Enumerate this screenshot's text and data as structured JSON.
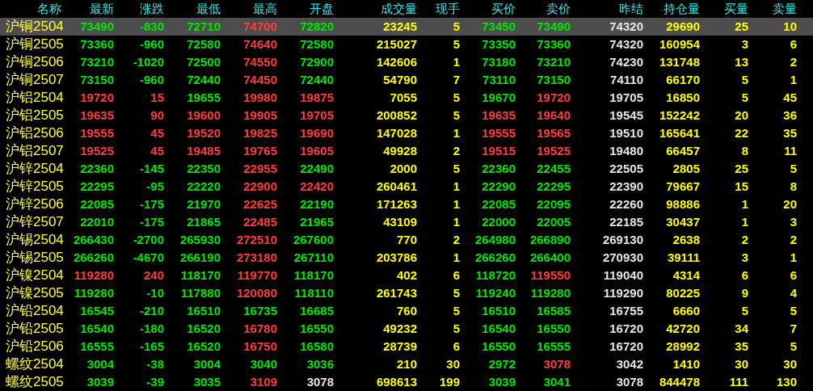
{
  "columns": [
    "名称",
    "最新",
    "涨跌",
    "最低",
    "最高",
    "开盘",
    "成交量",
    "现手",
    "买价",
    "卖价",
    "昨结",
    "持仓量",
    "买量",
    "卖量"
  ],
  "rows": [
    {
      "name": "沪铜2504",
      "selected": true,
      "cells": [
        {
          "text": "73490",
          "color": "#00e600"
        },
        {
          "text": "-830",
          "color": "#00e600"
        },
        {
          "text": "72710",
          "color": "#00e600"
        },
        {
          "text": "74700",
          "color": "#ff3c3c"
        },
        {
          "text": "72820",
          "color": "#00e600"
        },
        {
          "text": "23245",
          "color": "#ffff00"
        },
        {
          "text": "5",
          "color": "#ffff00"
        },
        {
          "text": "73450",
          "color": "#00e600"
        },
        {
          "text": "73490",
          "color": "#00e600"
        },
        {
          "text": "74320",
          "color": "#e6e6e6"
        },
        {
          "text": "29690",
          "color": "#ffff00"
        },
        {
          "text": "25",
          "color": "#ffff00"
        },
        {
          "text": "10",
          "color": "#ffff00"
        }
      ]
    },
    {
      "name": "沪铜2505",
      "selected": false,
      "cells": [
        {
          "text": "73360",
          "color": "#00e600"
        },
        {
          "text": "-960",
          "color": "#00e600"
        },
        {
          "text": "72580",
          "color": "#00e600"
        },
        {
          "text": "74640",
          "color": "#ff3c3c"
        },
        {
          "text": "72580",
          "color": "#00e600"
        },
        {
          "text": "215027",
          "color": "#ffff00"
        },
        {
          "text": "5",
          "color": "#ffff00"
        },
        {
          "text": "73350",
          "color": "#00e600"
        },
        {
          "text": "73360",
          "color": "#00e600"
        },
        {
          "text": "74320",
          "color": "#e6e6e6"
        },
        {
          "text": "160954",
          "color": "#ffff00"
        },
        {
          "text": "3",
          "color": "#ffff00"
        },
        {
          "text": "6",
          "color": "#ffff00"
        }
      ]
    },
    {
      "name": "沪铜2506",
      "selected": false,
      "cells": [
        {
          "text": "73210",
          "color": "#00e600"
        },
        {
          "text": "-1020",
          "color": "#00e600"
        },
        {
          "text": "72500",
          "color": "#00e600"
        },
        {
          "text": "74550",
          "color": "#ff3c3c"
        },
        {
          "text": "72900",
          "color": "#00e600"
        },
        {
          "text": "142606",
          "color": "#ffff00"
        },
        {
          "text": "1",
          "color": "#ffff00"
        },
        {
          "text": "73180",
          "color": "#00e600"
        },
        {
          "text": "73210",
          "color": "#00e600"
        },
        {
          "text": "74230",
          "color": "#e6e6e6"
        },
        {
          "text": "131748",
          "color": "#ffff00"
        },
        {
          "text": "13",
          "color": "#ffff00"
        },
        {
          "text": "2",
          "color": "#ffff00"
        }
      ]
    },
    {
      "name": "沪铜2507",
      "selected": false,
      "cells": [
        {
          "text": "73150",
          "color": "#00e600"
        },
        {
          "text": "-960",
          "color": "#00e600"
        },
        {
          "text": "72440",
          "color": "#00e600"
        },
        {
          "text": "74450",
          "color": "#ff3c3c"
        },
        {
          "text": "72440",
          "color": "#00e600"
        },
        {
          "text": "54790",
          "color": "#ffff00"
        },
        {
          "text": "7",
          "color": "#ffff00"
        },
        {
          "text": "73110",
          "color": "#00e600"
        },
        {
          "text": "73150",
          "color": "#00e600"
        },
        {
          "text": "74110",
          "color": "#e6e6e6"
        },
        {
          "text": "66170",
          "color": "#ffff00"
        },
        {
          "text": "5",
          "color": "#ffff00"
        },
        {
          "text": "1",
          "color": "#ffff00"
        }
      ]
    },
    {
      "name": "沪铝2504",
      "selected": false,
      "cells": [
        {
          "text": "19720",
          "color": "#ff3c3c"
        },
        {
          "text": "15",
          "color": "#ff3c3c"
        },
        {
          "text": "19655",
          "color": "#00e600"
        },
        {
          "text": "19980",
          "color": "#ff3c3c"
        },
        {
          "text": "19875",
          "color": "#ff3c3c"
        },
        {
          "text": "7055",
          "color": "#ffff00"
        },
        {
          "text": "5",
          "color": "#ffff00"
        },
        {
          "text": "19670",
          "color": "#00e600"
        },
        {
          "text": "19720",
          "color": "#ff3c3c"
        },
        {
          "text": "19705",
          "color": "#e6e6e6"
        },
        {
          "text": "16850",
          "color": "#ffff00"
        },
        {
          "text": "5",
          "color": "#ffff00"
        },
        {
          "text": "45",
          "color": "#ffff00"
        }
      ]
    },
    {
      "name": "沪铝2505",
      "selected": false,
      "cells": [
        {
          "text": "19635",
          "color": "#ff3c3c"
        },
        {
          "text": "90",
          "color": "#ff3c3c"
        },
        {
          "text": "19600",
          "color": "#ff3c3c"
        },
        {
          "text": "19905",
          "color": "#ff3c3c"
        },
        {
          "text": "19705",
          "color": "#ff3c3c"
        },
        {
          "text": "200852",
          "color": "#ffff00"
        },
        {
          "text": "5",
          "color": "#ffff00"
        },
        {
          "text": "19635",
          "color": "#ff3c3c"
        },
        {
          "text": "19640",
          "color": "#ff3c3c"
        },
        {
          "text": "19545",
          "color": "#e6e6e6"
        },
        {
          "text": "152242",
          "color": "#ffff00"
        },
        {
          "text": "20",
          "color": "#ffff00"
        },
        {
          "text": "36",
          "color": "#ffff00"
        }
      ]
    },
    {
      "name": "沪铝2506",
      "selected": false,
      "cells": [
        {
          "text": "19555",
          "color": "#ff3c3c"
        },
        {
          "text": "45",
          "color": "#ff3c3c"
        },
        {
          "text": "19520",
          "color": "#ff3c3c"
        },
        {
          "text": "19825",
          "color": "#ff3c3c"
        },
        {
          "text": "19690",
          "color": "#ff3c3c"
        },
        {
          "text": "147028",
          "color": "#ffff00"
        },
        {
          "text": "1",
          "color": "#ffff00"
        },
        {
          "text": "19555",
          "color": "#ff3c3c"
        },
        {
          "text": "19565",
          "color": "#ff3c3c"
        },
        {
          "text": "19510",
          "color": "#e6e6e6"
        },
        {
          "text": "165641",
          "color": "#ffff00"
        },
        {
          "text": "22",
          "color": "#ffff00"
        },
        {
          "text": "35",
          "color": "#ffff00"
        }
      ]
    },
    {
      "name": "沪铝2507",
      "selected": false,
      "cells": [
        {
          "text": "19525",
          "color": "#ff3c3c"
        },
        {
          "text": "45",
          "color": "#ff3c3c"
        },
        {
          "text": "19485",
          "color": "#ff3c3c"
        },
        {
          "text": "19765",
          "color": "#ff3c3c"
        },
        {
          "text": "19605",
          "color": "#ff3c3c"
        },
        {
          "text": "49928",
          "color": "#ffff00"
        },
        {
          "text": "2",
          "color": "#ffff00"
        },
        {
          "text": "19515",
          "color": "#ff3c3c"
        },
        {
          "text": "19525",
          "color": "#ff3c3c"
        },
        {
          "text": "19480",
          "color": "#e6e6e6"
        },
        {
          "text": "66457",
          "color": "#ffff00"
        },
        {
          "text": "8",
          "color": "#ffff00"
        },
        {
          "text": "11",
          "color": "#ffff00"
        }
      ]
    },
    {
      "name": "沪锌2504",
      "selected": false,
      "cells": [
        {
          "text": "22360",
          "color": "#00e600"
        },
        {
          "text": "-145",
          "color": "#00e600"
        },
        {
          "text": "22350",
          "color": "#00e600"
        },
        {
          "text": "22955",
          "color": "#ff3c3c"
        },
        {
          "text": "22490",
          "color": "#00e600"
        },
        {
          "text": "2000",
          "color": "#ffff00"
        },
        {
          "text": "5",
          "color": "#ffff00"
        },
        {
          "text": "22360",
          "color": "#00e600"
        },
        {
          "text": "22455",
          "color": "#00e600"
        },
        {
          "text": "22505",
          "color": "#e6e6e6"
        },
        {
          "text": "2805",
          "color": "#ffff00"
        },
        {
          "text": "25",
          "color": "#ffff00"
        },
        {
          "text": "5",
          "color": "#ffff00"
        }
      ]
    },
    {
      "name": "沪锌2505",
      "selected": false,
      "cells": [
        {
          "text": "22295",
          "color": "#00e600"
        },
        {
          "text": "-95",
          "color": "#00e600"
        },
        {
          "text": "22220",
          "color": "#00e600"
        },
        {
          "text": "22900",
          "color": "#ff3c3c"
        },
        {
          "text": "22420",
          "color": "#ff3c3c"
        },
        {
          "text": "260461",
          "color": "#ffff00"
        },
        {
          "text": "1",
          "color": "#ffff00"
        },
        {
          "text": "22290",
          "color": "#00e600"
        },
        {
          "text": "22295",
          "color": "#00e600"
        },
        {
          "text": "22390",
          "color": "#e6e6e6"
        },
        {
          "text": "79667",
          "color": "#ffff00"
        },
        {
          "text": "15",
          "color": "#ffff00"
        },
        {
          "text": "8",
          "color": "#ffff00"
        }
      ]
    },
    {
      "name": "沪锌2506",
      "selected": false,
      "cells": [
        {
          "text": "22085",
          "color": "#00e600"
        },
        {
          "text": "-175",
          "color": "#00e600"
        },
        {
          "text": "21970",
          "color": "#00e600"
        },
        {
          "text": "22625",
          "color": "#ff3c3c"
        },
        {
          "text": "22190",
          "color": "#00e600"
        },
        {
          "text": "171263",
          "color": "#ffff00"
        },
        {
          "text": "1",
          "color": "#ffff00"
        },
        {
          "text": "22085",
          "color": "#00e600"
        },
        {
          "text": "22095",
          "color": "#00e600"
        },
        {
          "text": "22260",
          "color": "#e6e6e6"
        },
        {
          "text": "98886",
          "color": "#ffff00"
        },
        {
          "text": "1",
          "color": "#ffff00"
        },
        {
          "text": "20",
          "color": "#ffff00"
        }
      ]
    },
    {
      "name": "沪锌2507",
      "selected": false,
      "cells": [
        {
          "text": "22010",
          "color": "#00e600"
        },
        {
          "text": "-175",
          "color": "#00e600"
        },
        {
          "text": "21865",
          "color": "#00e600"
        },
        {
          "text": "22485",
          "color": "#ff3c3c"
        },
        {
          "text": "21965",
          "color": "#00e600"
        },
        {
          "text": "43109",
          "color": "#ffff00"
        },
        {
          "text": "1",
          "color": "#ffff00"
        },
        {
          "text": "22000",
          "color": "#00e600"
        },
        {
          "text": "22005",
          "color": "#00e600"
        },
        {
          "text": "22185",
          "color": "#e6e6e6"
        },
        {
          "text": "30437",
          "color": "#ffff00"
        },
        {
          "text": "1",
          "color": "#ffff00"
        },
        {
          "text": "3",
          "color": "#ffff00"
        }
      ]
    },
    {
      "name": "沪锡2504",
      "selected": false,
      "cells": [
        {
          "text": "266430",
          "color": "#00e600"
        },
        {
          "text": "-2700",
          "color": "#00e600"
        },
        {
          "text": "265930",
          "color": "#00e600"
        },
        {
          "text": "272510",
          "color": "#ff3c3c"
        },
        {
          "text": "267600",
          "color": "#00e600"
        },
        {
          "text": "770",
          "color": "#ffff00"
        },
        {
          "text": "2",
          "color": "#ffff00"
        },
        {
          "text": "264980",
          "color": "#00e600"
        },
        {
          "text": "266890",
          "color": "#00e600"
        },
        {
          "text": "269130",
          "color": "#e6e6e6"
        },
        {
          "text": "2638",
          "color": "#ffff00"
        },
        {
          "text": "2",
          "color": "#ffff00"
        },
        {
          "text": "2",
          "color": "#ffff00"
        }
      ]
    },
    {
      "name": "沪锡2505",
      "selected": false,
      "cells": [
        {
          "text": "266260",
          "color": "#00e600"
        },
        {
          "text": "-4670",
          "color": "#00e600"
        },
        {
          "text": "266190",
          "color": "#00e600"
        },
        {
          "text": "273180",
          "color": "#ff3c3c"
        },
        {
          "text": "267110",
          "color": "#00e600"
        },
        {
          "text": "203786",
          "color": "#ffff00"
        },
        {
          "text": "1",
          "color": "#ffff00"
        },
        {
          "text": "266260",
          "color": "#00e600"
        },
        {
          "text": "266400",
          "color": "#00e600"
        },
        {
          "text": "270930",
          "color": "#e6e6e6"
        },
        {
          "text": "39111",
          "color": "#ffff00"
        },
        {
          "text": "3",
          "color": "#ffff00"
        },
        {
          "text": "1",
          "color": "#ffff00"
        }
      ]
    },
    {
      "name": "沪镍2504",
      "selected": false,
      "cells": [
        {
          "text": "119280",
          "color": "#ff3c3c"
        },
        {
          "text": "240",
          "color": "#ff3c3c"
        },
        {
          "text": "118170",
          "color": "#00e600"
        },
        {
          "text": "119770",
          "color": "#ff3c3c"
        },
        {
          "text": "118170",
          "color": "#00e600"
        },
        {
          "text": "402",
          "color": "#ffff00"
        },
        {
          "text": "6",
          "color": "#ffff00"
        },
        {
          "text": "118720",
          "color": "#00e600"
        },
        {
          "text": "119550",
          "color": "#ff3c3c"
        },
        {
          "text": "119040",
          "color": "#e6e6e6"
        },
        {
          "text": "4314",
          "color": "#ffff00"
        },
        {
          "text": "6",
          "color": "#ffff00"
        },
        {
          "text": "6",
          "color": "#ffff00"
        }
      ]
    },
    {
      "name": "沪镍2505",
      "selected": false,
      "cells": [
        {
          "text": "119280",
          "color": "#00e600"
        },
        {
          "text": "-10",
          "color": "#00e600"
        },
        {
          "text": "117880",
          "color": "#00e600"
        },
        {
          "text": "120080",
          "color": "#ff3c3c"
        },
        {
          "text": "118110",
          "color": "#00e600"
        },
        {
          "text": "261743",
          "color": "#ffff00"
        },
        {
          "text": "5",
          "color": "#ffff00"
        },
        {
          "text": "119240",
          "color": "#00e600"
        },
        {
          "text": "119280",
          "color": "#00e600"
        },
        {
          "text": "119290",
          "color": "#e6e6e6"
        },
        {
          "text": "80225",
          "color": "#ffff00"
        },
        {
          "text": "9",
          "color": "#ffff00"
        },
        {
          "text": "4",
          "color": "#ffff00"
        }
      ]
    },
    {
      "name": "沪铅2504",
      "selected": false,
      "cells": [
        {
          "text": "16545",
          "color": "#00e600"
        },
        {
          "text": "-210",
          "color": "#00e600"
        },
        {
          "text": "16510",
          "color": "#00e600"
        },
        {
          "text": "16735",
          "color": "#00e600"
        },
        {
          "text": "16685",
          "color": "#00e600"
        },
        {
          "text": "760",
          "color": "#ffff00"
        },
        {
          "text": "5",
          "color": "#ffff00"
        },
        {
          "text": "16510",
          "color": "#00e600"
        },
        {
          "text": "16585",
          "color": "#00e600"
        },
        {
          "text": "16755",
          "color": "#e6e6e6"
        },
        {
          "text": "6660",
          "color": "#ffff00"
        },
        {
          "text": "5",
          "color": "#ffff00"
        },
        {
          "text": "5",
          "color": "#ffff00"
        }
      ]
    },
    {
      "name": "沪铅2505",
      "selected": false,
      "cells": [
        {
          "text": "16540",
          "color": "#00e600"
        },
        {
          "text": "-180",
          "color": "#00e600"
        },
        {
          "text": "16520",
          "color": "#00e600"
        },
        {
          "text": "16780",
          "color": "#ff3c3c"
        },
        {
          "text": "16550",
          "color": "#00e600"
        },
        {
          "text": "49232",
          "color": "#ffff00"
        },
        {
          "text": "5",
          "color": "#ffff00"
        },
        {
          "text": "16540",
          "color": "#00e600"
        },
        {
          "text": "16550",
          "color": "#00e600"
        },
        {
          "text": "16720",
          "color": "#e6e6e6"
        },
        {
          "text": "42720",
          "color": "#ffff00"
        },
        {
          "text": "34",
          "color": "#ffff00"
        },
        {
          "text": "7",
          "color": "#ffff00"
        }
      ]
    },
    {
      "name": "沪铅2506",
      "selected": false,
      "cells": [
        {
          "text": "16555",
          "color": "#00e600"
        },
        {
          "text": "-165",
          "color": "#00e600"
        },
        {
          "text": "16520",
          "color": "#00e600"
        },
        {
          "text": "16750",
          "color": "#ff3c3c"
        },
        {
          "text": "16580",
          "color": "#00e600"
        },
        {
          "text": "28739",
          "color": "#ffff00"
        },
        {
          "text": "6",
          "color": "#ffff00"
        },
        {
          "text": "16550",
          "color": "#00e600"
        },
        {
          "text": "16555",
          "color": "#00e600"
        },
        {
          "text": "16720",
          "color": "#e6e6e6"
        },
        {
          "text": "28992",
          "color": "#ffff00"
        },
        {
          "text": "35",
          "color": "#ffff00"
        },
        {
          "text": "5",
          "color": "#ffff00"
        }
      ]
    },
    {
      "name": "螺纹2504",
      "selected": false,
      "cells": [
        {
          "text": "3004",
          "color": "#00e600"
        },
        {
          "text": "-38",
          "color": "#00e600"
        },
        {
          "text": "3004",
          "color": "#00e600"
        },
        {
          "text": "3040",
          "color": "#00e600"
        },
        {
          "text": "3036",
          "color": "#00e600"
        },
        {
          "text": "210",
          "color": "#ffff00"
        },
        {
          "text": "30",
          "color": "#ffff00"
        },
        {
          "text": "2972",
          "color": "#00e600"
        },
        {
          "text": "3078",
          "color": "#ff3c3c"
        },
        {
          "text": "3042",
          "color": "#e6e6e6"
        },
        {
          "text": "1410",
          "color": "#ffff00"
        },
        {
          "text": "30",
          "color": "#ffff00"
        },
        {
          "text": "30",
          "color": "#ffff00"
        }
      ]
    },
    {
      "name": "螺纹2505",
      "selected": false,
      "cells": [
        {
          "text": "3039",
          "color": "#00e600"
        },
        {
          "text": "-39",
          "color": "#00e600"
        },
        {
          "text": "3035",
          "color": "#00e600"
        },
        {
          "text": "3109",
          "color": "#ff3c3c"
        },
        {
          "text": "3078",
          "color": "#e6e6e6"
        },
        {
          "text": "698613",
          "color": "#ffff00"
        },
        {
          "text": "199",
          "color": "#ffff00"
        },
        {
          "text": "3039",
          "color": "#00e600"
        },
        {
          "text": "3041",
          "color": "#00e600"
        },
        {
          "text": "3078",
          "color": "#e6e6e6"
        },
        {
          "text": "844478",
          "color": "#ffff00"
        },
        {
          "text": "111",
          "color": "#ffff00"
        },
        {
          "text": "130",
          "color": "#ffff00"
        }
      ]
    }
  ]
}
